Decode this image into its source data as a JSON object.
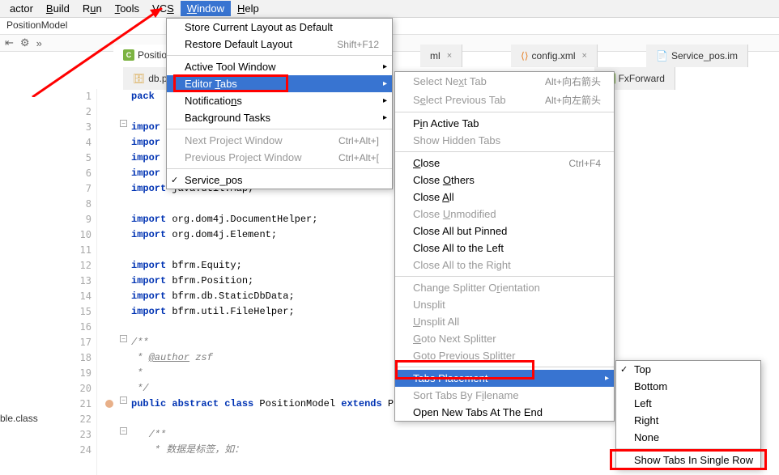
{
  "menubar": {
    "items": [
      "actor",
      "Build",
      "Run",
      "Tools",
      "VCS",
      "Window",
      "Help"
    ]
  },
  "breadcrumb": "PositionModel",
  "tabs_row1": [
    "Positio...",
    "ml",
    "config.xml",
    "Service_pos.im"
  ],
  "tabs_row2": [
    "db.pr",
    "FxForward"
  ],
  "sidebar_text": "ble.class",
  "gutter": [
    "1",
    "2",
    "3",
    "4",
    "5",
    "6",
    "7",
    "8",
    "9",
    "10",
    "11",
    "12",
    "13",
    "14",
    "15",
    "16",
    "17",
    "18",
    "19",
    "20",
    "21",
    "22",
    "23",
    "24"
  ],
  "code": {
    "l1_kw": "pack",
    "l3_kw": "impor",
    "l4_kw": "impor",
    "l5_kw": "impor",
    "l6_kw": "impor",
    "l7_kw": "import",
    "l7_b": " java.util.Map;",
    "l9_kw": "import",
    "l9_b": " org.dom4j.DocumentHelper;",
    "l10_kw": "import",
    "l10_b": " org.dom4j.Element;",
    "l12_kw": "import",
    "l12_b": " bfrm.Equity;",
    "l13_kw": "import",
    "l13_b": " bfrm.Position;",
    "l14_kw": "import",
    "l14_b": " bfrm.db.StaticDbData;",
    "l15_kw": "import",
    "l15_b": " bfrm.util.FileHelper;",
    "l17": "/**",
    "l18_a": " * ",
    "l18_tag": "@author",
    "l18_b": " zsf",
    "l19": " *",
    "l20": " */",
    "l21_a": "public abstract class",
    "l21_b": " PositionModel ",
    "l21_c": "extends",
    "l21_d": " Position {",
    "l23": "   /**",
    "l24": "    * 数据是标签，如："
  },
  "menu1": {
    "items": [
      {
        "label": "Store Current Layout as Default"
      },
      {
        "label": "Restore Default Layout",
        "shortcut": "Shift+F12"
      },
      {
        "sep": true
      },
      {
        "label": "Active Tool Window",
        "sub": true
      },
      {
        "label": "Editor Tabs",
        "sub": true,
        "selected": true
      },
      {
        "label": "Notifications",
        "sub": true
      },
      {
        "label": "Background Tasks",
        "sub": true
      },
      {
        "sep": true
      },
      {
        "label": "Next Project Window",
        "shortcut": "Ctrl+Alt+]",
        "disabled": true
      },
      {
        "label": "Previous Project Window",
        "shortcut": "Ctrl+Alt+[",
        "disabled": true
      },
      {
        "sep": true
      },
      {
        "label": "Service_pos",
        "checked": true
      }
    ]
  },
  "menu2": {
    "items": [
      {
        "label": "Select Next Tab",
        "shortcut": "Alt+向右箭头",
        "disabled": true
      },
      {
        "label": "Select Previous Tab",
        "shortcut": "Alt+向左箭头",
        "disabled": true
      },
      {
        "sep": true
      },
      {
        "label": "Pin Active Tab"
      },
      {
        "label": "Show Hidden Tabs",
        "disabled": true
      },
      {
        "sep": true
      },
      {
        "label": "Close",
        "shortcut": "Ctrl+F4"
      },
      {
        "label": "Close Others"
      },
      {
        "label": "Close All"
      },
      {
        "label": "Close Unmodified",
        "disabled": true
      },
      {
        "label": "Close All but Pinned"
      },
      {
        "label": "Close All to the Left"
      },
      {
        "label": "Close All to the Right",
        "disabled": true
      },
      {
        "sep": true
      },
      {
        "label": "Change Splitter Orientation",
        "disabled": true
      },
      {
        "label": "Unsplit",
        "disabled": true
      },
      {
        "label": "Unsplit All",
        "disabled": true
      },
      {
        "label": "Goto Next Splitter",
        "disabled": true
      },
      {
        "label": "Goto Previous Splitter",
        "disabled": true
      },
      {
        "sep": true
      },
      {
        "label": "Tabs Placement",
        "sub": true,
        "selected": true
      },
      {
        "label": "Sort Tabs By Filename",
        "disabled": true
      },
      {
        "label": "Open New Tabs At The End"
      }
    ]
  },
  "menu3": {
    "items": [
      {
        "label": "Top",
        "checked": true
      },
      {
        "label": "Bottom"
      },
      {
        "label": "Left"
      },
      {
        "label": "Right"
      },
      {
        "label": "None"
      },
      {
        "sep": true
      },
      {
        "label": "Show Tabs In Single Row"
      }
    ]
  }
}
